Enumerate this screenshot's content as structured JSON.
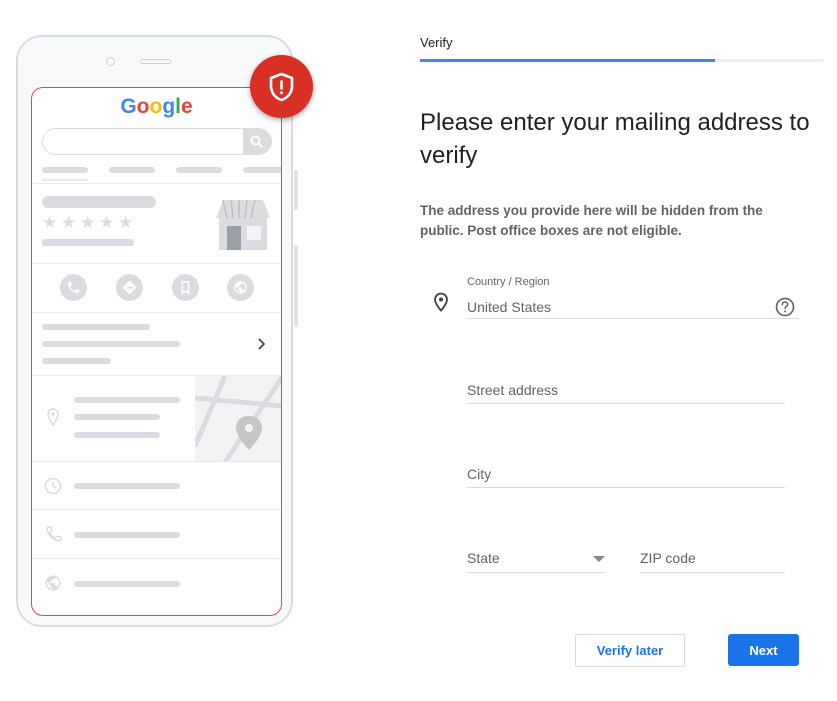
{
  "stepper": {
    "tab_label": "Verify",
    "progress_percent": 73
  },
  "illustration": {
    "logo_letters": [
      {
        "char": "G",
        "color": "#4285f4"
      },
      {
        "char": "o",
        "color": "#ea4335"
      },
      {
        "char": "o",
        "color": "#fbbc05"
      },
      {
        "char": "g",
        "color": "#4285f4"
      },
      {
        "char": "l",
        "color": "#34a853"
      },
      {
        "char": "e",
        "color": "#ea4335"
      }
    ],
    "rating_stars": 5,
    "badge_icon": "shield-alert-icon",
    "action_icons": [
      "phone-icon",
      "directions-icon",
      "bookmark-icon",
      "globe-icon"
    ],
    "info_row_icons": [
      "map-pin-icon",
      "clock-icon",
      "phone-icon",
      "globe-icon"
    ],
    "colors": {
      "badge": "#d93025",
      "placeholder_gray": "#dadce0"
    }
  },
  "main": {
    "heading": "Please enter your mailing address to verify",
    "description": "The address you provide here will be hidden from the public. Post office boxes are not eligible."
  },
  "form": {
    "country": {
      "label": "Country / Region",
      "value": "United States",
      "icon": "location-pin-icon",
      "help_icon": "help-circle-icon"
    },
    "street": {
      "placeholder": "Street address"
    },
    "city": {
      "placeholder": "City"
    },
    "state": {
      "placeholder": "State",
      "icon": "dropdown-caret-icon"
    },
    "zip": {
      "placeholder": "ZIP code"
    }
  },
  "actions": {
    "verify_later": "Verify later",
    "next": "Next"
  },
  "colors": {
    "accent": "#1a73e8",
    "progress": "#4285f4"
  }
}
